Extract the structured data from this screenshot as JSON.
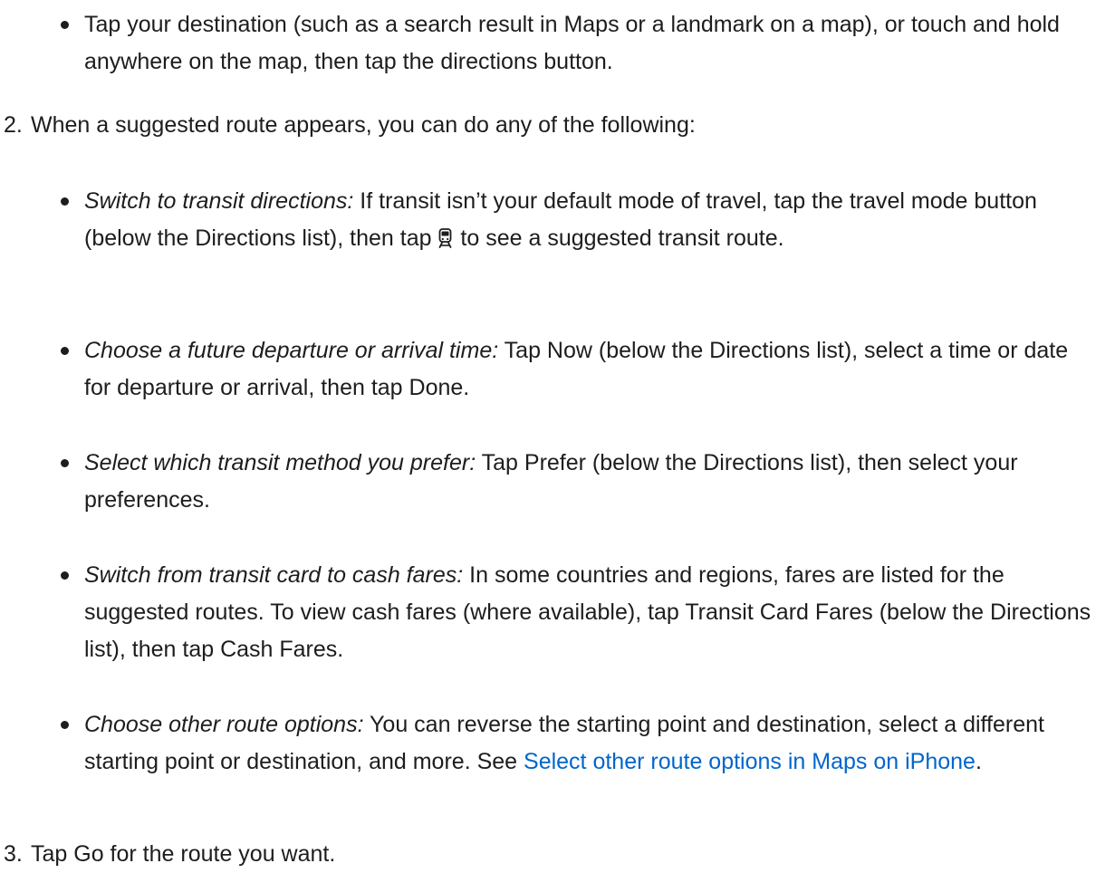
{
  "step1": {
    "bullet": "Tap your destination (such as a search result in Maps or a landmark on a map), or touch and hold anywhere on the map, then tap the directions button."
  },
  "step2": {
    "number": "2.",
    "text": "When a suggested route appears, you can do any of the following:",
    "bullets": [
      {
        "lead": "Switch to transit directions:",
        "text_before_icon": " If transit isn’t your default mode of travel, tap the travel mode button (below the Directions list), then tap ",
        "icon": "train-icon",
        "text_after_icon": " to see a suggested transit route."
      },
      {
        "lead": "Choose a future departure or arrival time:",
        "text": " Tap Now (below the Directions list), select a time or date for departure or arrival, then tap Done."
      },
      {
        "lead": "Select which transit method you prefer:",
        "text": " Tap Prefer (below the Directions list), then select your preferences."
      },
      {
        "lead": "Switch from transit card to cash fares:",
        "text": " In some countries and regions, fares are listed for the suggested routes. To view cash fares (where available), tap Transit Card Fares (below the Directions list), then tap Cash Fares."
      },
      {
        "lead": "Choose other route options:",
        "text": " You can reverse the starting point and destination, select a different starting point or destination, and more. See ",
        "link": "Select other route options in Maps on iPhone",
        "text_after_link": "."
      }
    ]
  },
  "step3": {
    "number": "3.",
    "text": "Tap Go for the route you want."
  },
  "colors": {
    "text": "#1d1d1f",
    "link": "#0066cc"
  }
}
